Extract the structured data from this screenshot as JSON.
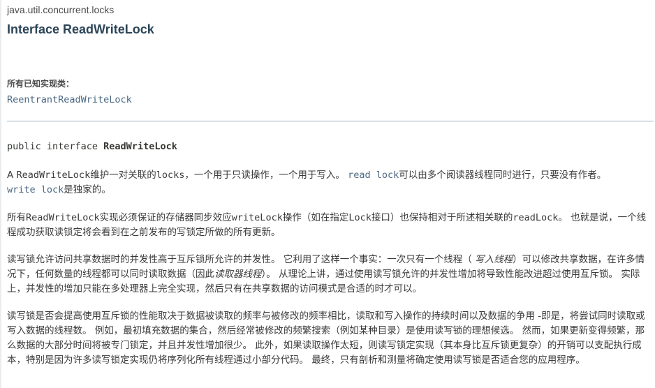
{
  "header": {
    "package": "java.util.concurrent.locks",
    "title": "Interface ReadWriteLock"
  },
  "known_impl": {
    "label": "所有已知实现类：",
    "link": "ReentrantReadWriteLock"
  },
  "declaration": {
    "prefix": "public interface ",
    "name": "ReadWriteLock"
  },
  "para1": {
    "a": "A ",
    "b": "ReadWriteLock",
    "c": "维护一对关联的",
    "d": "locks",
    "e": "，一个用于只读操作，一个用于写入。 ",
    "f": "read lock",
    "g": "可以由多个阅读器线程同时进行，只要没有作者。",
    "h": "write lock",
    "i": "是独家的。"
  },
  "para2": {
    "a": "所有",
    "b": "ReadWriteLock",
    "c": "实现必须保证的存储器同步效应",
    "d": "writeLock",
    "e": "操作（如在指定",
    "f": "Lock",
    "g": "接口）也保持相对于所述相关联的",
    "h": "readLock",
    "i": "。 也就是说，一个线程成功获取读锁定将会看到在之前发布的写锁定所做的所有更新。"
  },
  "para3": {
    "a": "读写锁允许访问共享数据时的并发性高于互斥锁所允许的并发性。 它利用了这样一个事实：一次只有一个线程（ ",
    "b": "写入线程",
    "c": "）可以修改共享数据，在许多情况下，任何数量的线程都可以同时读取数据（因此",
    "d": "读取器线程",
    "e": "）。 从理论上讲，通过使用读写锁允许的并发性增加将导致性能改进超过使用互斥锁。 实际上，并发性的增加只能在多处理器上完全实现，然后只有在共享数据的访问模式是合适的时才可以。"
  },
  "para4": {
    "text": "读写锁是否会提高使用互斥锁的性能取决于数据被读取的频率与被修改的频率相比，读取和写入操作的持续时间以及数据的争用 -即是，将尝试同时读取或写入数据的线程数。 例如，最初填充数据的集合，然后经常被修改的频繁搜索（例如某种目录）是使用读写锁的理想候选。 然而，如果更新变得频繁，那么数据的大部分时间将被专门锁定，并且并发性增加很少。 此外，如果读取操作太短，则读写锁定实现（其本身比互斥锁更复杂）的开销可以支配执行成本，特别是因为许多读写锁定实现仍将序列化所有线程通过小部分代码。 最终，只有剖析和测量将确定使用读写锁是否适合您的应用程序。"
  }
}
